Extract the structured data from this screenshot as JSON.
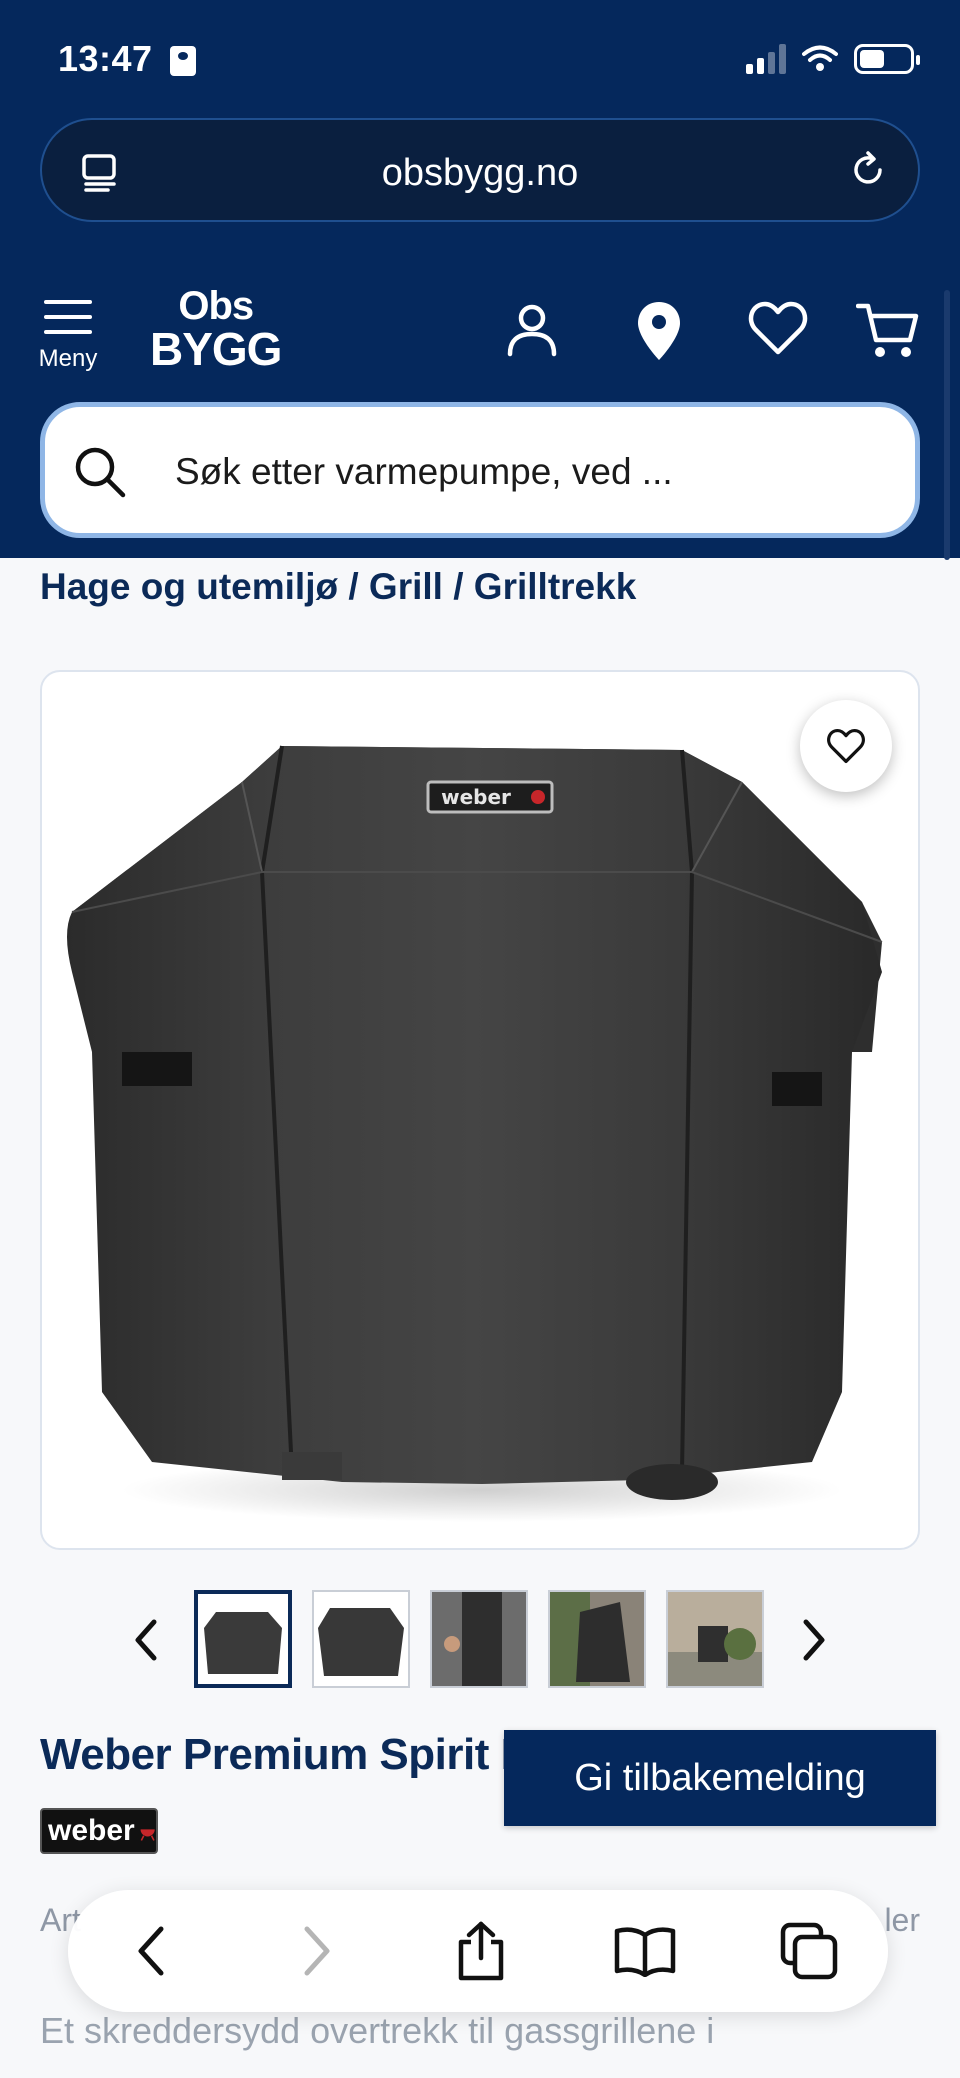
{
  "status_bar": {
    "time": "13:47"
  },
  "browser": {
    "url": "obsbygg.no"
  },
  "header": {
    "menu_label": "Meny",
    "logo_line1": "Obs",
    "logo_line2": "BYGG",
    "search_placeholder": "Søk etter varmepumpe, ved ..."
  },
  "breadcrumb": [
    "Hage og utemiljø",
    "Grill",
    "Grilltrekk"
  ],
  "breadcrumb_separator": "/",
  "product": {
    "title": "Weber Premium Spirit II 2",
    "brand": "weber",
    "thumbnail_count": 5,
    "selected_thumbnail": 1,
    "article_prefix": "Art",
    "right_fragment": "ler",
    "description_start": "Et skreddersydd overtrekk til gassgrillene i"
  },
  "feedback_button": "Gi tilbakemelding",
  "colors": {
    "brand_navy": "#05285c",
    "search_border": "#8fb6e6",
    "text_navy": "#0b2a58"
  },
  "icons": [
    "tabs-icon",
    "reload-icon",
    "menu-icon",
    "user-icon",
    "location-pin-icon",
    "heart-icon",
    "cart-icon",
    "search-icon",
    "back-icon",
    "forward-icon",
    "share-icon",
    "bookmarks-icon",
    "tabs-overview-icon"
  ]
}
